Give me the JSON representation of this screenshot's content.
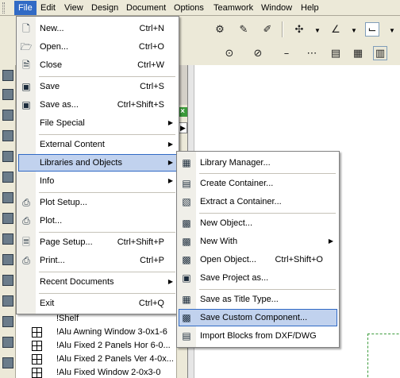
{
  "menubar": {
    "items": [
      {
        "label": "File",
        "active": true
      },
      {
        "label": "Edit"
      },
      {
        "label": "View"
      },
      {
        "label": "Design"
      },
      {
        "label": "Document"
      },
      {
        "label": "Options"
      },
      {
        "label": "Teamwork"
      },
      {
        "label": "Window"
      },
      {
        "label": "Help"
      }
    ]
  },
  "file_menu": {
    "items": [
      {
        "label": "New...",
        "shortcut": "Ctrl+N",
        "icon": "new-document-icon"
      },
      {
        "label": "Open...",
        "shortcut": "Ctrl+O",
        "icon": "open-folder-icon"
      },
      {
        "label": "Close",
        "shortcut": "Ctrl+W",
        "icon": "close-document-icon"
      },
      {
        "label": "Save",
        "shortcut": "Ctrl+S",
        "icon": "save-disk-icon"
      },
      {
        "label": "Save as...",
        "shortcut": "Ctrl+Shift+S",
        "icon": "save-as-icon"
      },
      {
        "label": "File Special",
        "submenu": true
      },
      {
        "label": "External Content",
        "submenu": true
      },
      {
        "label": "Libraries and Objects",
        "submenu": true,
        "highlighted": true
      },
      {
        "label": "Info",
        "submenu": true
      },
      {
        "label": "Plot Setup...",
        "icon": "plot-setup-icon"
      },
      {
        "label": "Plot...",
        "icon": "plotter-icon"
      },
      {
        "label": "Page Setup...",
        "shortcut": "Ctrl+Shift+P",
        "icon": "page-setup-icon"
      },
      {
        "label": "Print...",
        "shortcut": "Ctrl+P",
        "icon": "printer-icon"
      },
      {
        "label": "Recent Documents",
        "submenu": true
      },
      {
        "label": "Exit",
        "shortcut": "Ctrl+Q"
      }
    ]
  },
  "libraries_submenu": {
    "items": [
      {
        "label": "Library Manager...",
        "icon": "library-manager-icon"
      },
      {
        "label": "Create Container...",
        "icon": "create-container-icon"
      },
      {
        "label": "Extract a Container...",
        "icon": "extract-container-icon"
      },
      {
        "label": "New Object...",
        "icon": "new-object-icon"
      },
      {
        "label": "New With",
        "submenu": true,
        "icon": "new-with-icon"
      },
      {
        "label": "Open Object...",
        "shortcut": "Ctrl+Shift+O",
        "icon": "open-object-icon"
      },
      {
        "label": "Save Project as...",
        "icon": "save-project-icon"
      },
      {
        "label": "Save as Title Type...",
        "icon": "title-type-icon"
      },
      {
        "label": "Save Custom Component...",
        "icon": "custom-component-icon",
        "highlighted": true
      },
      {
        "label": "Import Blocks from DXF/DWG",
        "icon": "import-blocks-icon"
      }
    ]
  },
  "library_list": {
    "items": [
      "!Shelf",
      "!Alu Awning Window 3-0x1-6",
      "!Alu Fixed 2 Panels Hor 6-0...",
      "!Alu Fixed 2 Panels Ver 4-0x...",
      "!Alu Fixed Window 2-0x3-0"
    ]
  },
  "colors": {
    "menu_highlight": "#c1d2ee",
    "menu_highlight_border": "#316ac5",
    "menubar_active": "#316ac5",
    "panel_close": "#3a9a3a"
  }
}
